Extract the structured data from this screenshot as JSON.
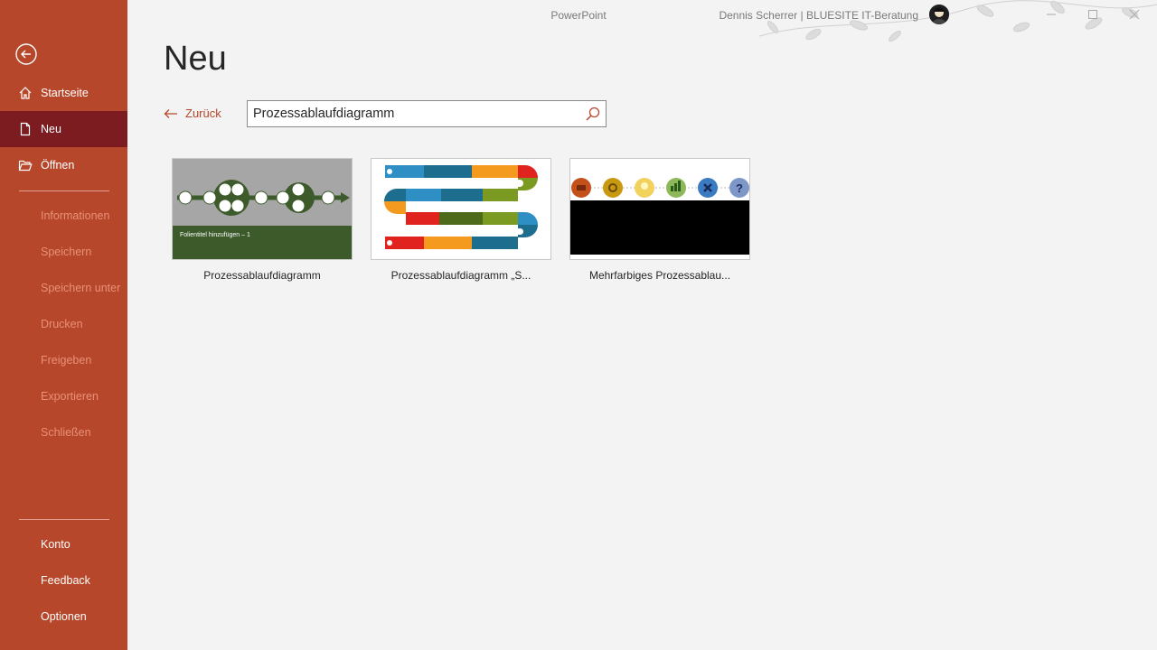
{
  "app": {
    "title": "PowerPoint",
    "user": "Dennis Scherrer | BLUESITE IT-Beratung"
  },
  "sidebar": {
    "items": [
      {
        "label": "Startseite",
        "icon": "home-icon",
        "state": "normal"
      },
      {
        "label": "Neu",
        "icon": "new-document-icon",
        "state": "active"
      },
      {
        "label": "Öffnen",
        "icon": "folder-open-icon",
        "state": "normal"
      },
      {
        "label": "Informationen",
        "state": "disabled"
      },
      {
        "label": "Speichern",
        "state": "disabled"
      },
      {
        "label": "Speichern unter",
        "state": "disabled"
      },
      {
        "label": "Drucken",
        "state": "disabled"
      },
      {
        "label": "Freigeben",
        "state": "disabled"
      },
      {
        "label": "Exportieren",
        "state": "disabled"
      },
      {
        "label": "Schließen",
        "state": "disabled"
      }
    ],
    "bottom": [
      {
        "label": "Konto"
      },
      {
        "label": "Feedback"
      },
      {
        "label": "Optionen"
      }
    ]
  },
  "main": {
    "title": "Neu",
    "back_label": "Zurück",
    "search": {
      "value": "Prozessablaufdiagramm"
    }
  },
  "templates": [
    {
      "name": "Prozessablaufdiagramm",
      "thumb_text": "Folientitel hinzufügen – 1"
    },
    {
      "name": "Prozessablaufdiagramm „S..."
    },
    {
      "name": "Mehrfarbiges Prozessablau..."
    }
  ],
  "colors": {
    "sidebar": "#b7472a",
    "sidebar_active": "#7c1c20",
    "accent": "#b7472a"
  }
}
